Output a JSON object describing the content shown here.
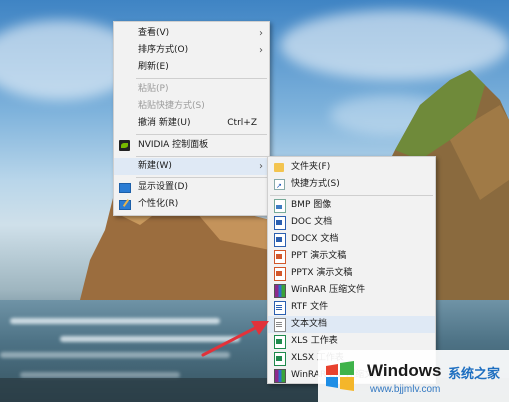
{
  "context_menu": {
    "items": [
      {
        "label": "查看(V)",
        "submenu": true
      },
      {
        "label": "排序方式(O)",
        "submenu": true
      },
      {
        "label": "刷新(E)"
      },
      {
        "label": "粘贴(P)",
        "disabled": true
      },
      {
        "label": "粘贴快捷方式(S)",
        "disabled": true
      },
      {
        "label": "撤消 新建(U)",
        "shortcut": "Ctrl+Z"
      },
      {
        "label": "NVIDIA 控制面板",
        "icon": "nvidia-icon"
      },
      {
        "label": "新建(W)",
        "submenu": true,
        "highlighted": true
      },
      {
        "label": "显示设置(D)",
        "icon": "display-settings-icon"
      },
      {
        "label": "个性化(R)",
        "icon": "personalize-icon"
      }
    ]
  },
  "new_submenu": {
    "items": [
      {
        "label": "文件夹(F)",
        "icon": "folder-icon"
      },
      {
        "label": "快捷方式(S)",
        "icon": "shortcut-icon"
      },
      {
        "label": "BMP 图像",
        "icon": "bmp-file-icon"
      },
      {
        "label": "DOC 文档",
        "icon": "doc-file-icon"
      },
      {
        "label": "DOCX 文档",
        "icon": "docx-file-icon"
      },
      {
        "label": "PPT 演示文稿",
        "icon": "ppt-file-icon"
      },
      {
        "label": "PPTX 演示文稿",
        "icon": "pptx-file-icon"
      },
      {
        "label": "WinRAR 压缩文件",
        "icon": "winrar-icon"
      },
      {
        "label": "RTF 文件",
        "icon": "rtf-file-icon"
      },
      {
        "label": "文本文档",
        "icon": "text-file-icon",
        "highlighted": true
      },
      {
        "label": "XLS 工作表",
        "icon": "xls-file-icon"
      },
      {
        "label": "XLSX 工作表",
        "icon": "xlsx-file-icon"
      },
      {
        "label": "WinRAR ZIP 压缩文件",
        "icon": "winrar-zip-icon"
      }
    ]
  },
  "watermark": {
    "title": "Windows",
    "title_cn": "系统之家",
    "url": "www.bjjmlv.com"
  },
  "colors": {
    "menu_bg": "#f2f2f2",
    "highlight": "#dfe9f5",
    "arrow_annotation": "#e2323a",
    "brand_blue": "#1e6fc0"
  }
}
